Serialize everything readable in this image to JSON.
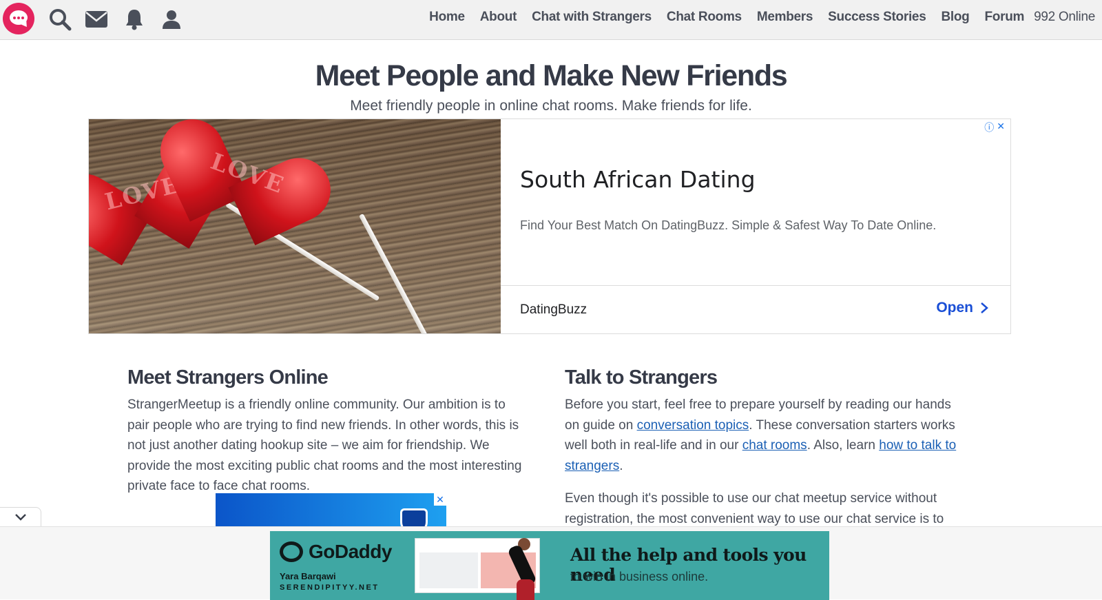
{
  "header": {
    "nav": [
      "Home",
      "About",
      "Chat with Strangers",
      "Chat Rooms",
      "Members",
      "Success Stories",
      "Blog",
      "Forum"
    ],
    "online_count": "992 Online",
    "icons": [
      "chat-logo-icon",
      "search-icon",
      "mail-icon",
      "bell-icon",
      "user-icon"
    ]
  },
  "hero": {
    "title": "Meet People and Make New Friends",
    "subtitle": "Meet friendly people in online chat rooms. Make friends for life."
  },
  "ad": {
    "image_text": [
      "LOVE",
      "LOVE"
    ],
    "headline": "South African Dating",
    "description": "Find Your Best Match On DatingBuzz. Simple & Safest Way To Date Online.",
    "brand": "DatingBuzz",
    "cta": "Open",
    "info_icon": "ⓘ",
    "close_icon": "✕"
  },
  "left_section": {
    "title": "Meet Strangers Online",
    "body": "StrangerMeetup is a friendly online community. Our ambition is to pair people who are trying to find new friends. In other words, this is not just another dating hookup site – we aim for friendship. We provide the most exciting public chat rooms and the most interesting private face to face chat rooms."
  },
  "right_section": {
    "title": "Talk to Strangers",
    "p1_part1": "Before you start, feel free to prepare yourself by reading our hands on guide on ",
    "link1": "conversation topics",
    "p1_part2": ". These conversation starters works well both in real-life and in our ",
    "link2": "chat rooms",
    "p1_part3": ". Also, learn ",
    "link3": "how to talk to strangers",
    "p1_part4": ".",
    "p2": "Even though it's possible to use our chat meetup service without registration, the most convenient way to use our chat service is to"
  },
  "bottom_ad": {
    "logo_text": "GoDaddy",
    "name": "Yara Barqawi",
    "site": "SERENDIPITYY.NET",
    "headline": "All the help and tools you need",
    "subline": "to win in business online."
  },
  "colors": {
    "accent_pink": "#e4245e",
    "link_blue": "#1a5fb4",
    "ad_cta_blue": "#1a4fd6",
    "godaddy_teal": "#3fa7a3"
  }
}
